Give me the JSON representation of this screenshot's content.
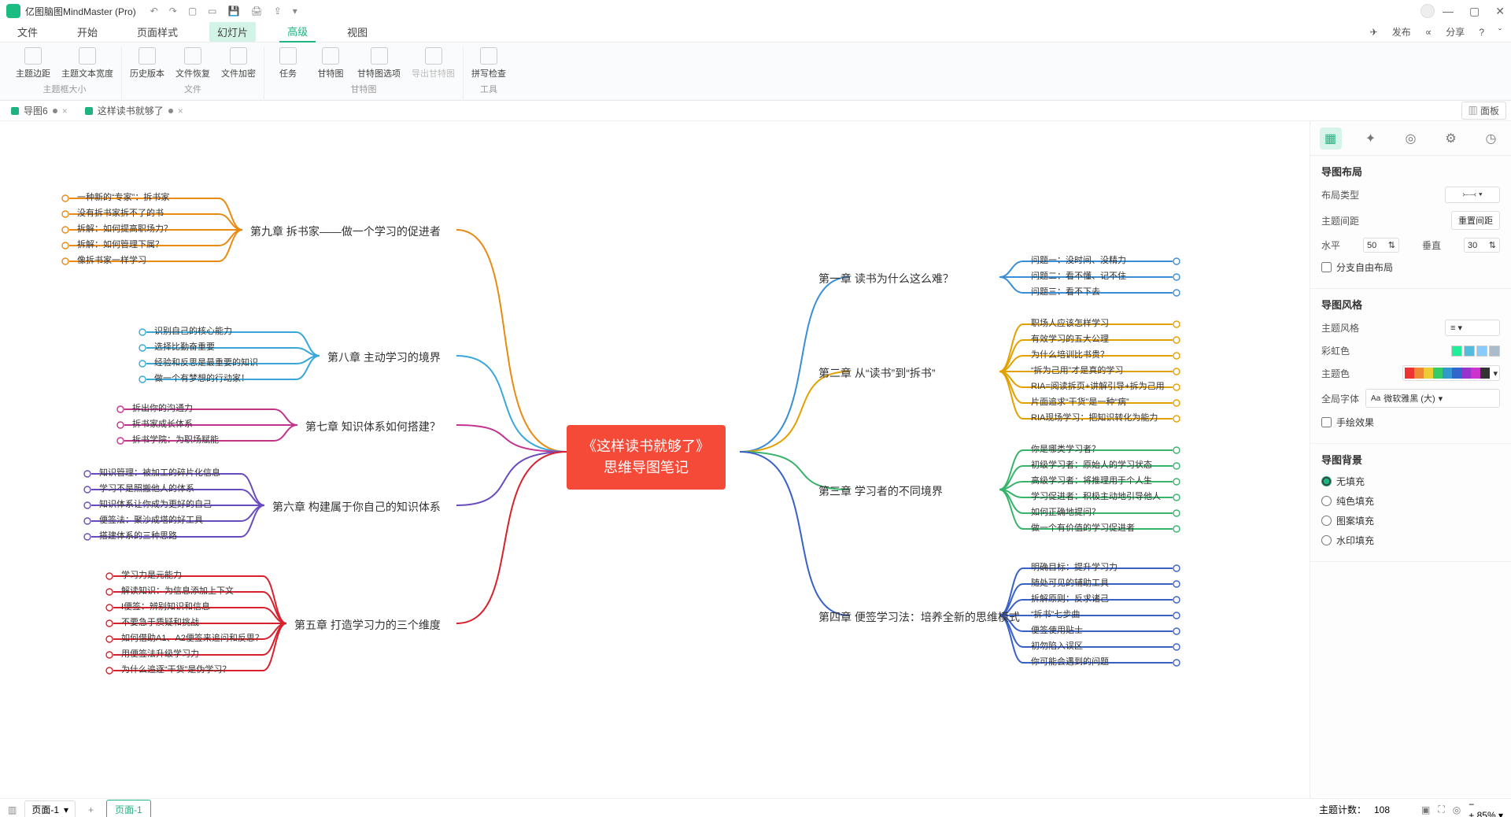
{
  "app": {
    "title": "亿图脑图MindMaster (Pro)"
  },
  "qat": {
    "undo": "↶",
    "redo": "↷",
    "new": "▢",
    "open": "▭",
    "save": "💾",
    "print": "🖨",
    "export": "⇪",
    "more": "▾"
  },
  "window_controls": {
    "min": "—",
    "max": "▢",
    "close": "✕"
  },
  "menubar": {
    "items": [
      "文件",
      "开始",
      "页面样式",
      "幻灯片",
      "高级",
      "视图"
    ],
    "right": {
      "publish": "发布",
      "share": "分享",
      "help": "?",
      "collapse": "ˇ",
      "pub_icon": "✈",
      "share_icon": "∝"
    }
  },
  "ribbon": {
    "groups": [
      {
        "label": "主题框大小",
        "buttons": [
          {
            "label": "主题边距",
            "disabled": false
          },
          {
            "label": "主题文本宽度",
            "disabled": false
          }
        ]
      },
      {
        "label": "文件",
        "buttons": [
          {
            "label": "历史版本",
            "disabled": false
          },
          {
            "label": "文件恢复",
            "disabled": false
          },
          {
            "label": "文件加密",
            "disabled": false
          }
        ]
      },
      {
        "label": "甘特图",
        "buttons": [
          {
            "label": "任务",
            "disabled": false
          },
          {
            "label": "甘特图",
            "disabled": false
          },
          {
            "label": "甘特图选项",
            "disabled": false
          },
          {
            "label": "导出甘特图",
            "disabled": true
          }
        ]
      },
      {
        "label": "工具",
        "buttons": [
          {
            "label": "拼写检查",
            "disabled": false
          }
        ]
      }
    ]
  },
  "doctabs": {
    "tabs": [
      {
        "label": "导图6"
      },
      {
        "label": "这样读书就够了"
      }
    ],
    "panel_toggle": "面板"
  },
  "mindmap": {
    "central": "《这样读书就够了》\n思维导图笔记",
    "right_chapters": [
      {
        "title": "第一章 读书为什么这么难？",
        "color": "#3a8ed6",
        "nodes": [
          "问题一：没时间、没精力",
          "问题二：看不懂、记不住",
          "问题三：看不下去"
        ]
      },
      {
        "title": "第二章 从“读书”到“拆书”",
        "color": "#e2a100",
        "nodes": [
          "职场人应该怎样学习",
          "有效学习的五大公理",
          "为什么培训比书贵？",
          "“拆为己用”才是真的学习",
          "RIA=阅读拆页+讲解引导+拆为己用",
          "片面追求“干货”是一种“病”",
          "RIA现场学习：把知识转化为能力"
        ]
      },
      {
        "title": "第三章 学习者的不同境界",
        "color": "#38b36b",
        "nodes": [
          "你是哪类学习者？",
          "初级学习者：原始人的学习状态",
          "高级学习者：将推理用于个人生",
          "学习促进者：积极主动地引导他人",
          "如何正确地提问？",
          "做一个有价值的学习促进者"
        ]
      },
      {
        "title": "第四章 便签学习法：培养全新的思维模式",
        "color": "#3860c9",
        "nodes": [
          "明确目标：提升学习力",
          "随处可见的辅助工具",
          "拆解原则：反求诸己",
          "“拆书”七步曲",
          "便签使用贴士",
          "初勿陷入误区",
          "你可能会遇到的问题"
        ]
      }
    ],
    "left_chapters": [
      {
        "title": "第九章 拆书家——做一个学习的促进者",
        "color": "#e98a13",
        "nodes": [
          "一种新的“专家”：拆书家",
          "没有拆书家拆不了的书",
          "拆解：如何提高职场力？",
          "拆解：如何管理下属？",
          "像拆书家一样学习"
        ]
      },
      {
        "title": "第八章 主动学习的境界",
        "color": "#3aa7d9",
        "nodes": [
          "识别自己的核心能力",
          "选择比勤奋重要",
          "经验和反思是最重要的知识",
          "做一个有梦想的行动家！"
        ]
      },
      {
        "title": "第七章 知识体系如何搭建？",
        "color": "#c1338f",
        "nodes": [
          "拆出你的沟通力",
          "拆书家成长体系",
          "拆书学院：为职场赋能"
        ]
      },
      {
        "title": "第六章 构建属于你自己的知识体系",
        "color": "#6a4bbf",
        "nodes": [
          "知识管理：被加工的碎片化信息",
          "学习不是照搬他人的体系",
          "知识体系让你成为更好的自己",
          "便签法：聚沙成塔的好工具",
          "搭建体系的三种思路"
        ]
      },
      {
        "title": "第五章 打造学习力的三个维度",
        "color": "#d6222d",
        "nodes": [
          "学习力是元能力",
          "解读知识：为信息添加上下文",
          "I便签：辨别知识和信息",
          "不要急于质疑和挑战",
          "如何借助A1、A2便签来追问和反思？",
          "用便签法升级学习力",
          "为什么追逐“干货”是伪学习？"
        ]
      }
    ]
  },
  "sidepanel": {
    "tabs": [
      "▦",
      "✦",
      "◎",
      "⚙",
      "◷"
    ],
    "sections": {
      "layout_title": "导图布局",
      "layout_type_label": "布局类型",
      "theme_gap_label": "主题间距",
      "reset_gap": "重置间距",
      "horiz_label": "水平",
      "horiz_val": "50",
      "vert_label": "垂直",
      "vert_val": "30",
      "branch_free": "分支自由布局",
      "style_title": "导图风格",
      "theme_style_label": "主题风格",
      "rainbow_label": "彩虹色",
      "theme_color_label": "主题色",
      "global_font_label": "全局字体",
      "global_font_val": "微软雅黑 (大)",
      "hand_effect": "手绘效果",
      "bg_title": "导图背景",
      "bg_options": [
        "无填充",
        "纯色填充",
        "图案填充",
        "水印填充"
      ]
    }
  },
  "pagebar": {
    "select_label": "页面-1",
    "active_tab": "页面-1"
  },
  "statusbar": {
    "topic_count_label": "主题计数：",
    "topic_count": "108",
    "zoom": "85%"
  }
}
